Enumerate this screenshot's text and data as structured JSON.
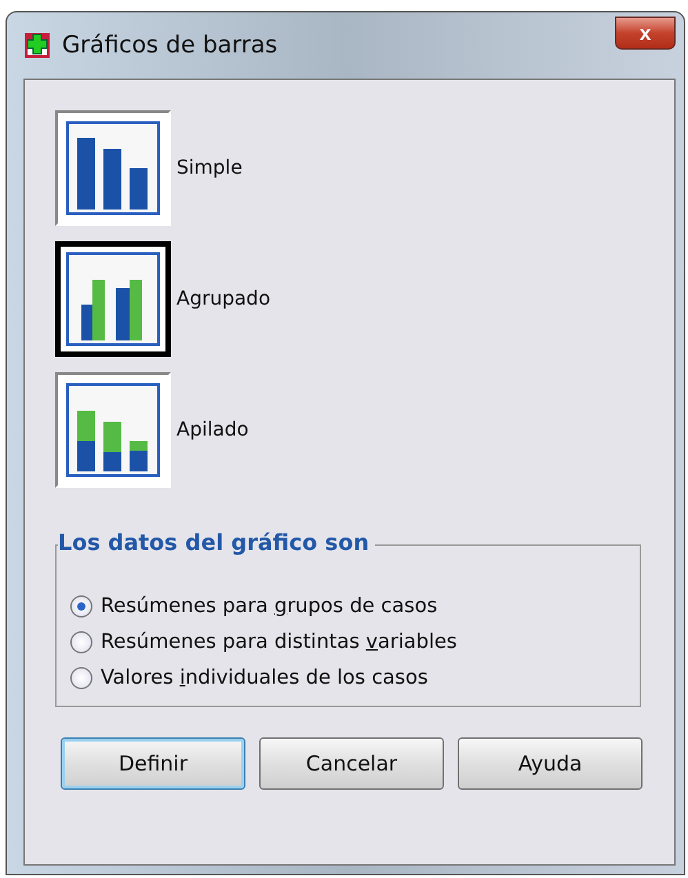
{
  "window": {
    "title": "Gráficos de barras",
    "close": "x"
  },
  "chart_types": [
    {
      "kind": "simple",
      "label": "Simple",
      "selected": false
    },
    {
      "kind": "clustered",
      "label": "Agrupado",
      "selected": true
    },
    {
      "kind": "stacked",
      "label": "Apilado",
      "selected": false
    }
  ],
  "data_group": {
    "title": "Los datos del gráfico son",
    "options": [
      {
        "label_start": "Resúmenes para ",
        "access_key": "g",
        "label_end": "rupos de casos",
        "selected": true
      },
      {
        "label_start": "Resúmenes para distintas ",
        "access_key": "v",
        "label_end": "ariables",
        "selected": false
      },
      {
        "label_start": "Valores ",
        "access_key": "i",
        "label_end": "ndividuales de los casos",
        "selected": false
      }
    ]
  },
  "buttons": [
    {
      "label": "Definir",
      "default": true
    },
    {
      "label": "Cancelar",
      "default": false
    },
    {
      "label": "Ayuda",
      "default": false
    }
  ]
}
